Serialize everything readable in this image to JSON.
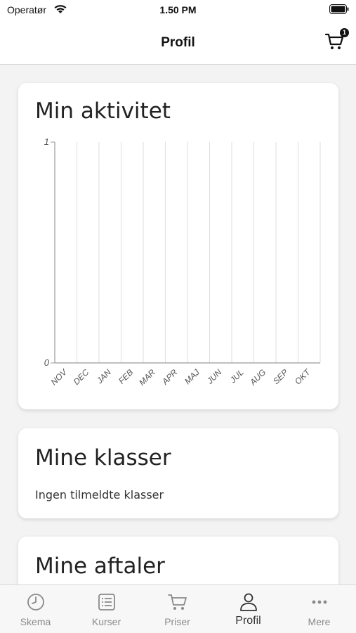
{
  "status_bar": {
    "carrier": "Operatør",
    "time": "1.50 PM"
  },
  "nav": {
    "title": "Profil",
    "cart_count": "1"
  },
  "activity": {
    "title": "Min aktivitet"
  },
  "chart_data": {
    "type": "bar",
    "categories": [
      "NOV",
      "DEC",
      "JAN",
      "FEB",
      "MAR",
      "APR",
      "MAJ",
      "JUN",
      "JUL",
      "AUG",
      "SEP",
      "OKT"
    ],
    "values": [
      0,
      0,
      0,
      0,
      0,
      0,
      0,
      0,
      0,
      0,
      0,
      0
    ],
    "ylim": [
      0,
      1
    ],
    "yticks": [
      "0",
      "1"
    ],
    "grid": true
  },
  "classes": {
    "title": "Mine klasser",
    "empty_text": "Ingen tilmeldte klasser"
  },
  "appointments": {
    "title": "Mine aftaler"
  },
  "tabs": [
    {
      "label": "Skema",
      "icon": "clock-icon"
    },
    {
      "label": "Kurser",
      "icon": "list-icon"
    },
    {
      "label": "Priser",
      "icon": "cart-icon"
    },
    {
      "label": "Profil",
      "icon": "person-icon"
    },
    {
      "label": "Mere",
      "icon": "more-icon"
    }
  ],
  "colors": {
    "active_tab": "#333333",
    "inactive_tab": "#8a8a8a",
    "background": "#f3f3f3"
  }
}
